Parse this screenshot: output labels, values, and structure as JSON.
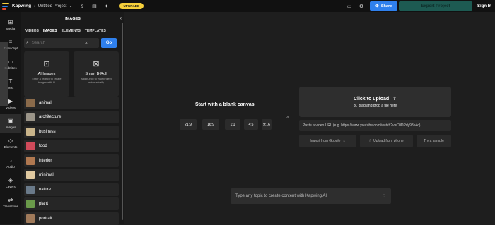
{
  "header": {
    "brand": "Kapwing",
    "separator": "/",
    "project": "Untitled Project",
    "upgrade": "UPGRADE",
    "share": "Share",
    "export": "Export Project",
    "signin": "Sign In",
    "logo_colors": [
      "#f7d03b",
      "#2f80ed",
      "#e4462c",
      "#b76cf5"
    ]
  },
  "nav": [
    {
      "label": "Media",
      "icon": "media-icon"
    },
    {
      "label": "Transcript",
      "icon": "transcript-icon"
    },
    {
      "label": "Subtitles",
      "icon": "subtitles-icon"
    },
    {
      "label": "Text",
      "icon": "text-icon"
    },
    {
      "label": "Videos",
      "icon": "videos-icon"
    },
    {
      "label": "Images",
      "icon": "images-icon"
    },
    {
      "label": "Elements",
      "icon": "elements-icon"
    },
    {
      "label": "Audio",
      "icon": "audio-icon"
    },
    {
      "label": "Layers",
      "icon": "layers-icon"
    },
    {
      "label": "Transitions",
      "icon": "transitions-icon"
    }
  ],
  "panel": {
    "title": "IMAGES",
    "tabs": [
      "VIDEOS",
      "IMAGES",
      "ELEMENTS",
      "TEMPLATES"
    ],
    "search_placeholder": "Search",
    "go": "Go",
    "cards": [
      {
        "title": "AI Images",
        "desc": "Enter a prompt to create images with AI"
      },
      {
        "title": "Smart B-Roll",
        "desc": "Add B-Roll to your project automatically"
      }
    ],
    "categories": [
      {
        "label": "animal",
        "color": "#8a6a4a"
      },
      {
        "label": "architecture",
        "color": "#9a9488"
      },
      {
        "label": "business",
        "color": "#c9b48a"
      },
      {
        "label": "food",
        "color": "#d04a5a"
      },
      {
        "label": "interior",
        "color": "#b07850"
      },
      {
        "label": "minimal",
        "color": "#e0c9a0"
      },
      {
        "label": "nature",
        "color": "#6a7a8a"
      },
      {
        "label": "plant",
        "color": "#6a9a4a"
      },
      {
        "label": "portrait",
        "color": "#a07a5a"
      }
    ]
  },
  "canvas": {
    "blank_title": "Start with a blank canvas",
    "ratios": [
      "21:9",
      "16:9",
      "1:1",
      "4:5",
      "9:16"
    ],
    "or": "or",
    "upload_title": "Click to upload",
    "upload_sub": "or, drag and drop a file here",
    "url_placeholder": "Paste a video URL (e.g. https://www.youtube.com/watch?v=C0DPdy98e4c)",
    "import_google": "Import from Google",
    "upload_phone": "Upload from phone",
    "try_sample": "Try a sample",
    "ai_prompt": "Type any topic to create content with Kapwing AI"
  }
}
